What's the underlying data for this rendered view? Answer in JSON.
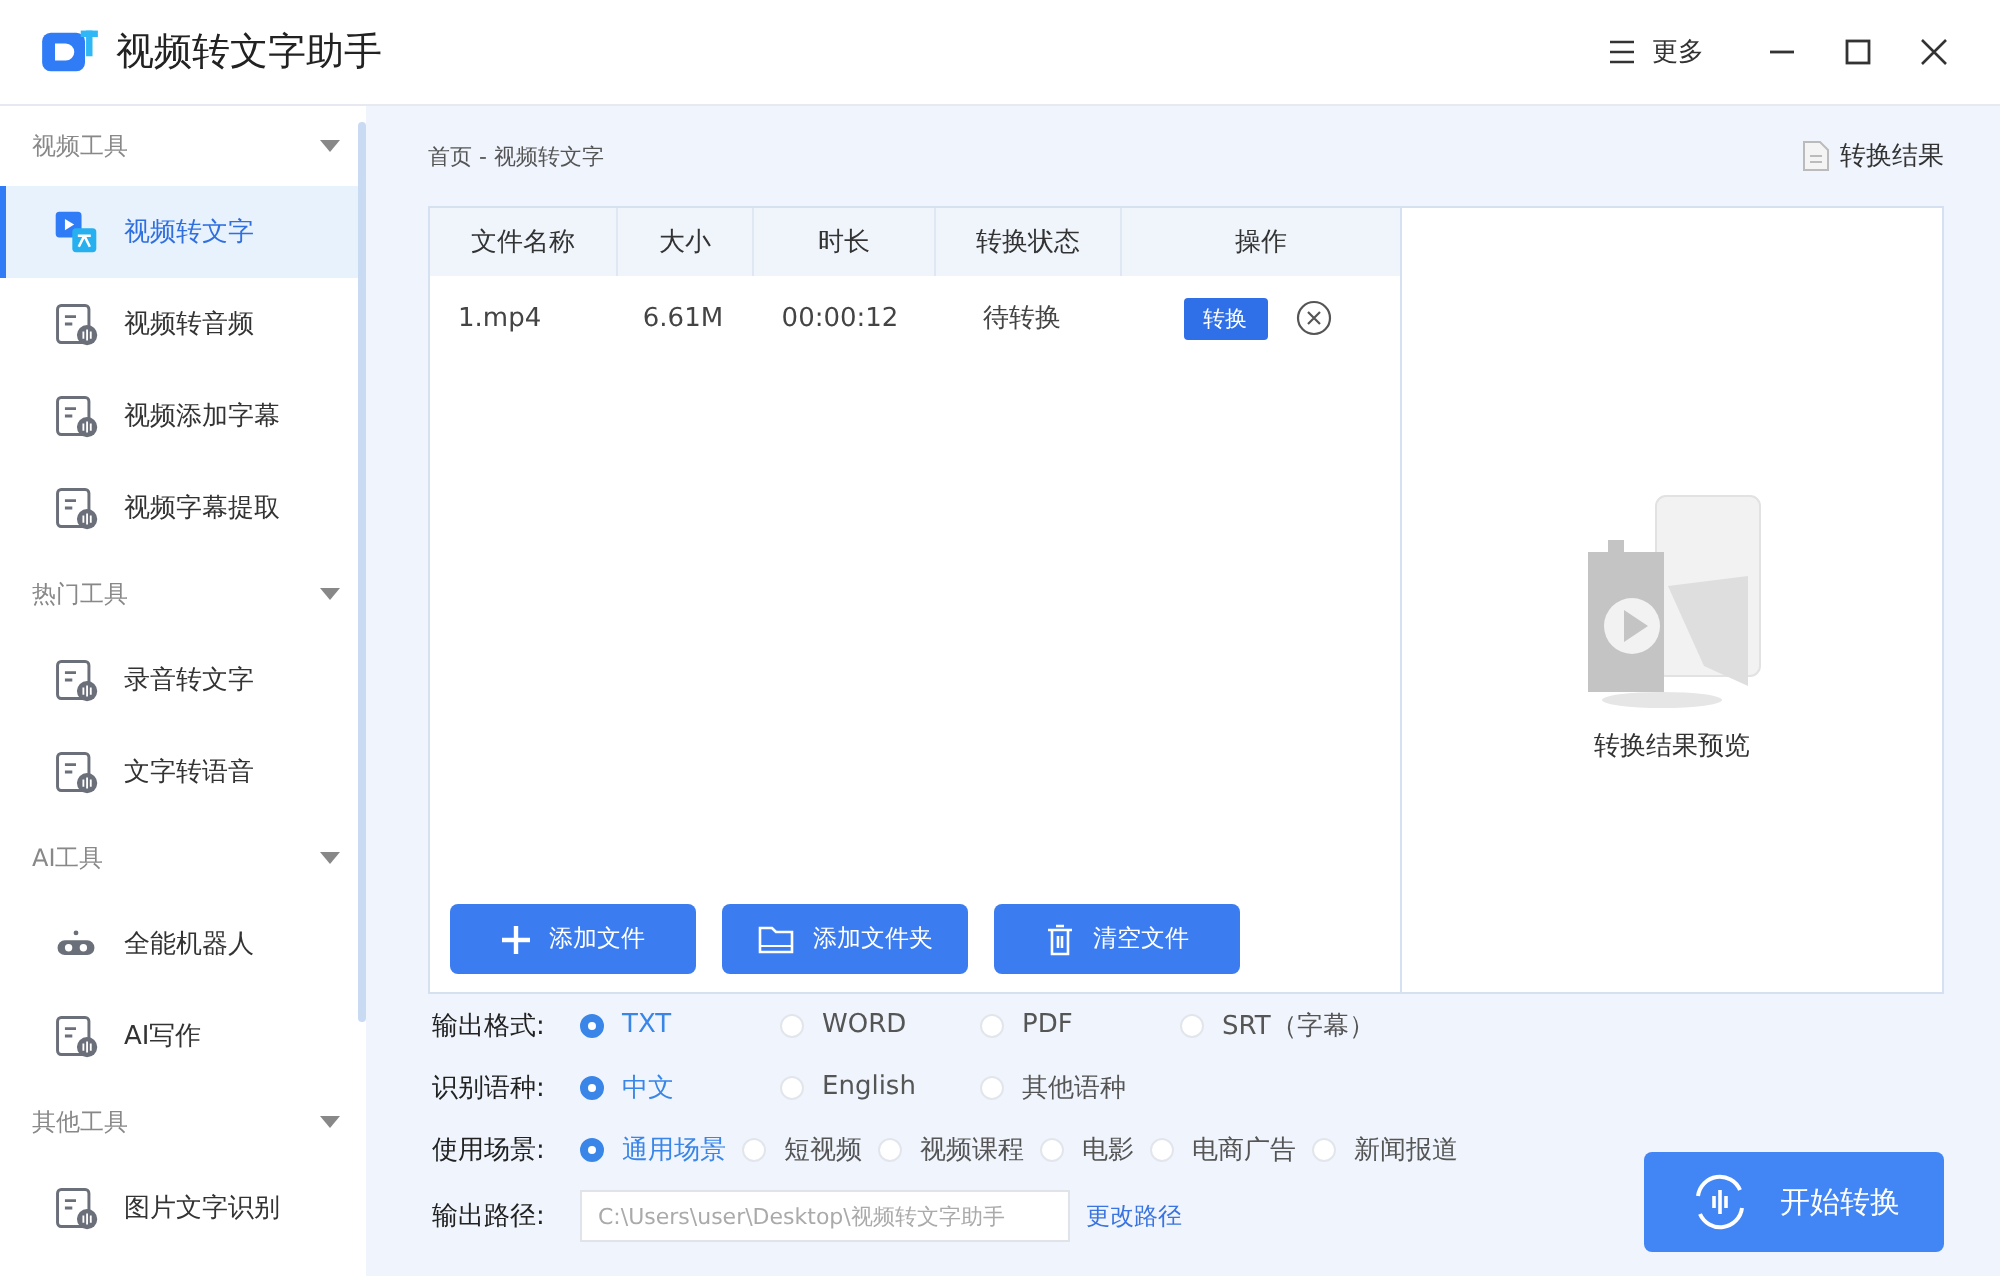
{
  "window": {
    "title": "视频转文字助手",
    "more": "更多"
  },
  "sidebar": {
    "groups": [
      {
        "label": "视频工具",
        "expanded": true,
        "items": [
          {
            "label": "视频转文字",
            "selected": true
          },
          {
            "label": "视频转音频",
            "selected": false
          },
          {
            "label": "视频添加字幕",
            "selected": false
          },
          {
            "label": "视频字幕提取",
            "selected": false
          }
        ]
      },
      {
        "label": "热门工具",
        "expanded": true,
        "items": [
          {
            "label": "录音转文字",
            "selected": false
          },
          {
            "label": "文字转语音",
            "selected": false
          }
        ]
      },
      {
        "label": "AI工具",
        "expanded": true,
        "items": [
          {
            "label": "全能机器人",
            "selected": false
          },
          {
            "label": "AI写作",
            "selected": false
          }
        ]
      },
      {
        "label": "其他工具",
        "expanded": true,
        "items": [
          {
            "label": "图片文字识别",
            "selected": false
          }
        ]
      }
    ]
  },
  "breadcrumb": "首页 - 视频转文字",
  "result_link": "转换结果",
  "table": {
    "columns": [
      "文件名称",
      "大小",
      "时长",
      "转换状态",
      "操作"
    ],
    "rows": [
      {
        "name": "1.mp4",
        "size": "6.61M",
        "duration": "00:00:12",
        "status": "待转换",
        "action": "转换"
      }
    ]
  },
  "file_buttons": [
    "添加文件",
    "添加文件夹",
    "清空文件"
  ],
  "preview": {
    "label": "转换结果预览"
  },
  "options": [
    {
      "label": "输出格式:",
      "choices": [
        {
          "label": "TXT",
          "selected": true
        },
        {
          "label": "WORD",
          "selected": false
        },
        {
          "label": "PDF",
          "selected": false
        },
        {
          "label": "SRT（字幕）",
          "selected": false
        }
      ]
    },
    {
      "label": "识别语种:",
      "choices": [
        {
          "label": "中文",
          "selected": true
        },
        {
          "label": "English",
          "selected": false
        },
        {
          "label": "其他语种",
          "selected": false
        }
      ]
    },
    {
      "label": "使用场景:",
      "choices": [
        {
          "label": "通用场景",
          "selected": true
        },
        {
          "label": "短视频",
          "selected": false
        },
        {
          "label": "视频课程",
          "selected": false
        },
        {
          "label": "电影",
          "selected": false
        },
        {
          "label": "电商广告",
          "selected": false
        },
        {
          "label": "新闻报道",
          "selected": false
        }
      ]
    }
  ],
  "output_path": {
    "label": "输出路径:",
    "placeholder": "C:\\Users\\user\\Desktop\\视频转文字助手",
    "change": "更改路径"
  },
  "start_button": "开始转换"
}
